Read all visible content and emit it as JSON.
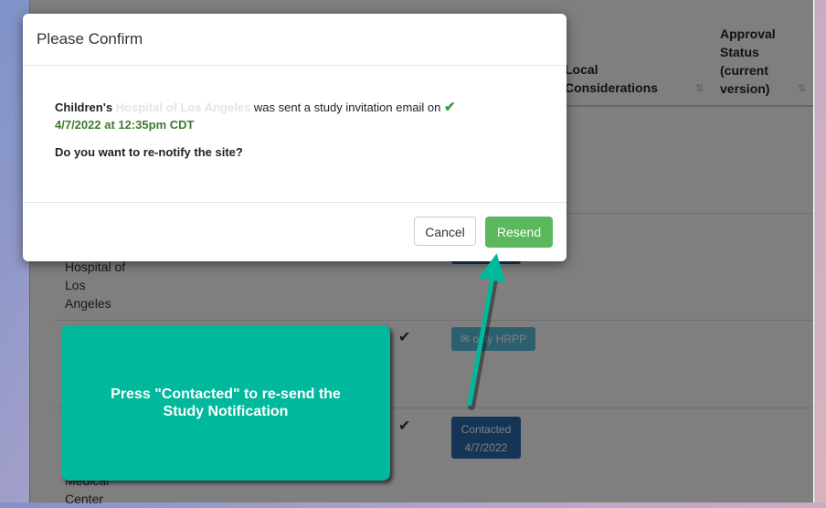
{
  "table": {
    "headers": {
      "local_considerations_line1": "Local",
      "local_considerations_line2": "Considerations",
      "approval_status_line1": "Approval",
      "approval_status_line2": "Status",
      "approval_status_line3": "(current",
      "approval_status_line4": "version)"
    },
    "rows": [
      {
        "site_lines": [
          "Hospital of",
          "Los",
          "Angeles"
        ],
        "action_label": ""
      },
      {
        "site_lines": [],
        "action_label": "otify HRPP"
      },
      {
        "site_lines": [
          "Medical",
          "Center"
        ],
        "action_line1": "Contacted",
        "action_line2": "4/7/2022"
      }
    ]
  },
  "modal": {
    "title": "Please Confirm",
    "site_name_visible": "Children's",
    "site_name_obscured": "Hospital of Los Angeles",
    "message": "was sent a study invitation email on",
    "sent_datetime": "4/7/2022 at 12:35pm CDT",
    "question": "Do you want to re-notify the site?",
    "cancel_label": "Cancel",
    "resend_label": "Resend"
  },
  "callout": {
    "line1": "Press \"Contacted\" to re-send the",
    "line2": "Study Notification"
  },
  "colors": {
    "resend": "#5cb85c",
    "callout": "#00b89c",
    "contacted": "#2a6aad",
    "notify": "#5bc0de"
  }
}
